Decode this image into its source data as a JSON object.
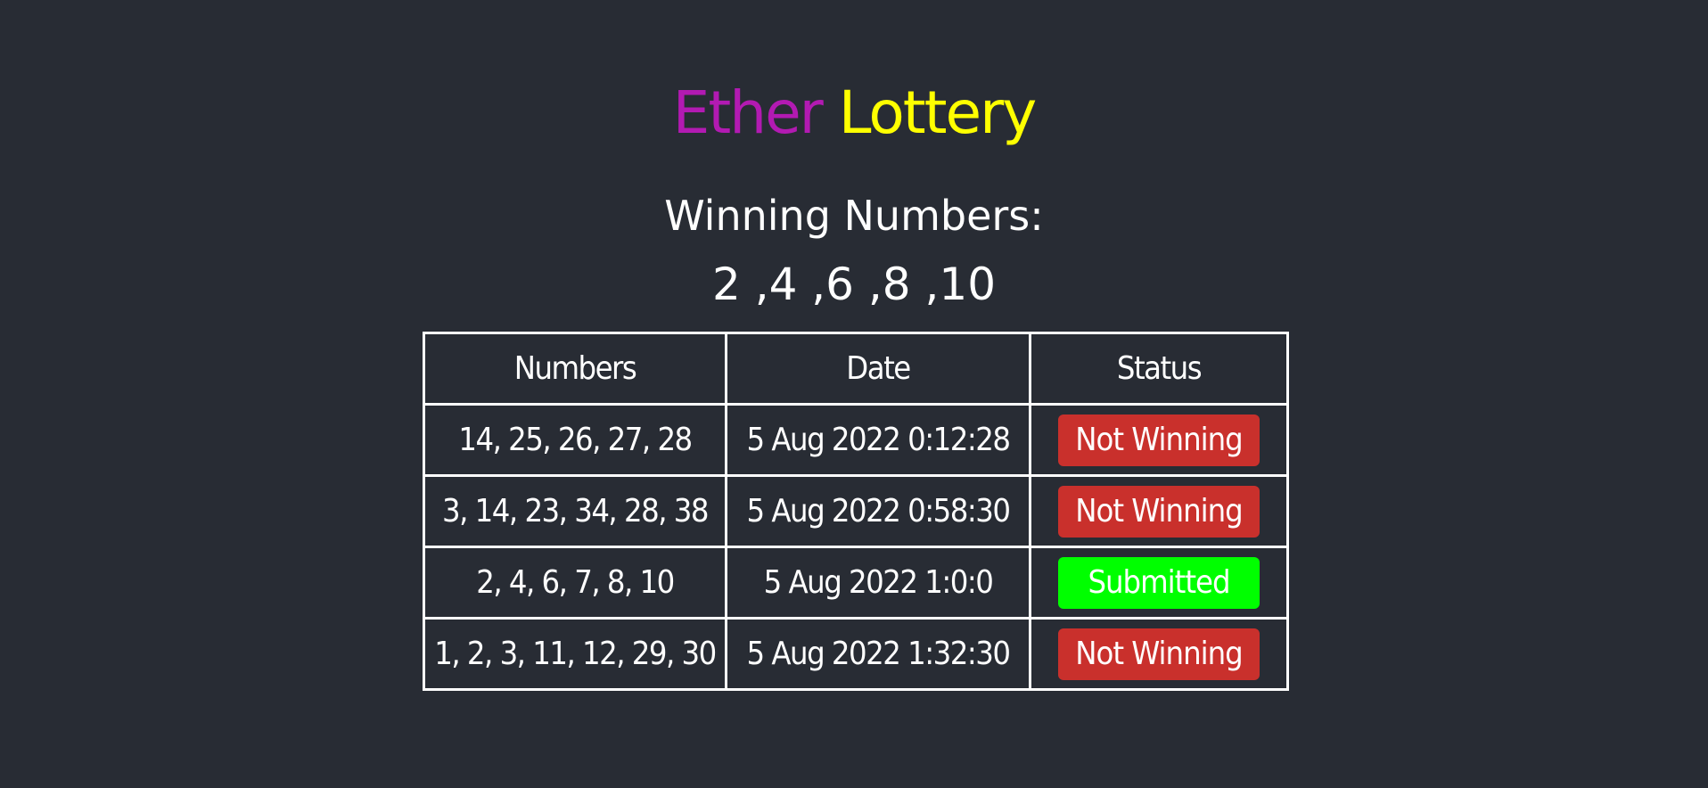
{
  "title": {
    "part1": "Ether",
    "part2": "Lottery",
    "part1_color": "#b21ab2",
    "part2_color": "#ffff00"
  },
  "winning": {
    "label": "Winning Numbers:",
    "numbers": "2 ,4 ,6 ,8 ,10"
  },
  "table": {
    "headers": {
      "numbers": "Numbers",
      "date": "Date",
      "status": "Status"
    },
    "rows": [
      {
        "numbers": "14, 25, 26, 27, 28",
        "date": "5 Aug 2022 0:12:28",
        "status": "Not Winning"
      },
      {
        "numbers": "3, 14, 23, 34, 28, 38",
        "date": "5 Aug 2022 0:58:30",
        "status": "Not Winning"
      },
      {
        "numbers": "2, 4, 6, 7, 8, 10",
        "date": "5 Aug 2022 1:0:0",
        "status": "Submitted"
      },
      {
        "numbers": "1, 2, 3, 11, 12, 29, 30",
        "date": "5 Aug 2022 1:32:30",
        "status": "Not Winning"
      }
    ]
  },
  "colors": {
    "background": "#282c34",
    "not_winning": "#c9302c",
    "submitted": "#00ff00"
  }
}
